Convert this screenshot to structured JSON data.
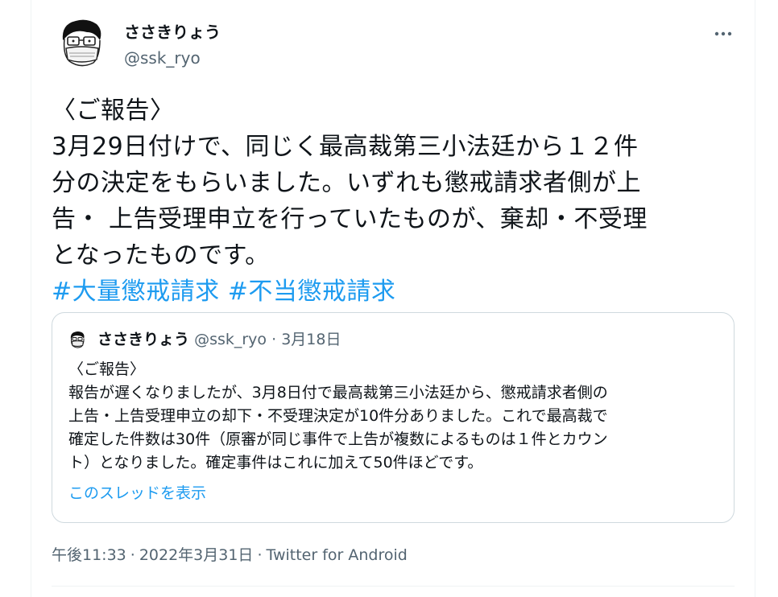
{
  "author": {
    "display_name": "ささきりょう",
    "handle": "@ssk_ryo"
  },
  "tweet": {
    "lines": [
      "〈ご報告〉",
      "3月29日付けで、同じく最高裁第三小法廷から１２件",
      "分の決定をもらいました。いずれも懲戒請求者側が上",
      "告・ 上告受理申立を行っていたものが、棄却・不受理",
      "となったものです。"
    ],
    "hashtags": [
      "#大量懲戒請求",
      "#不当懲戒請求"
    ]
  },
  "quoted_tweet": {
    "display_name": "ささきりょう",
    "handle": "@ssk_ryo",
    "separator": "·",
    "date": "3月18日",
    "lines": [
      "〈ご報告〉",
      "報告が遅くなりましたが、3月8日付で最高裁第三小法廷から、懲戒請求者側の",
      "上告・上告受理申立の却下・不受理決定が10件分ありました。これで最高裁で",
      "確定した件数は30件（原審が同じ事件で上告が複数によるものは１件とカウン",
      "ト）となりました。確定事件はこれに加えて50件ほどです。"
    ],
    "thread_link": "このスレッドを表示"
  },
  "meta": {
    "time": "午後11:33",
    "separator": "·",
    "date": "2022年3月31日",
    "source": "Twitter for Android"
  },
  "icons": {
    "more": "more-horizontal-icon"
  },
  "colors": {
    "text": "#0f1419",
    "secondary": "#536471",
    "link": "#1d9bf0",
    "border": "#cfd9de"
  }
}
